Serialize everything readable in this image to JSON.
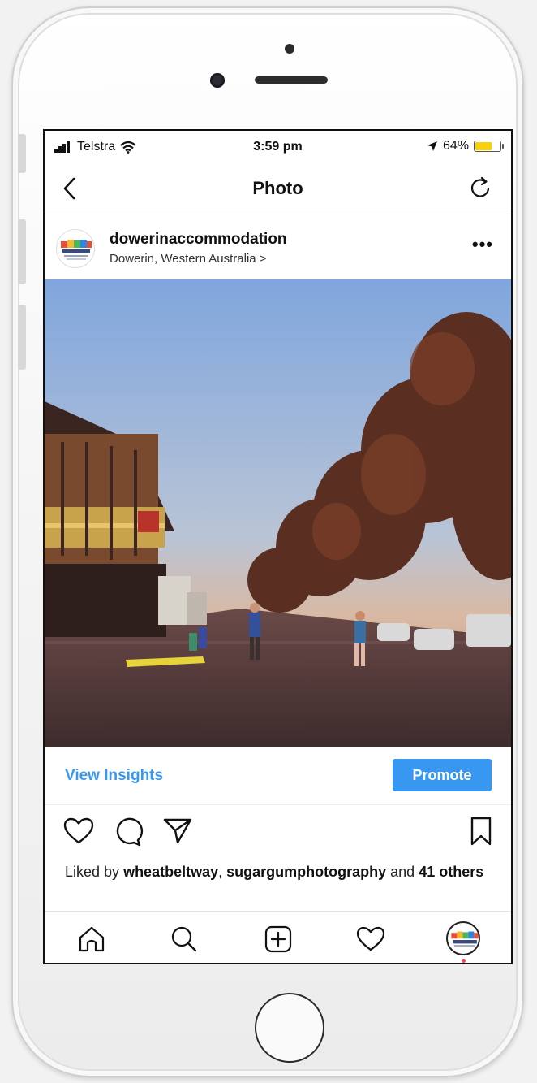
{
  "status_bar": {
    "carrier": "Telstra",
    "time": "3:59 pm",
    "battery": "64%",
    "battery_level": 0.64
  },
  "nav": {
    "title": "Photo"
  },
  "post": {
    "username": "dowerinaccommodation",
    "location": "Dowerin, Western Australia >"
  },
  "insights": {
    "view_label": "View Insights",
    "promote_label": "Promote"
  },
  "likes": {
    "prefix": "Liked by",
    "user1": "wheatbeltway",
    "sep": ",",
    "user2": "sugargumphotography",
    "and": "and",
    "others": "41 others"
  },
  "colors": {
    "accent": "#3897f0",
    "battery": "#f6d10c"
  },
  "icons": [
    "back-chevron-icon",
    "refresh-icon",
    "more-options-icon",
    "heart-icon",
    "comment-icon",
    "share-icon",
    "bookmark-icon",
    "home-icon",
    "search-icon",
    "add-post-icon",
    "activity-heart-icon",
    "profile-avatar"
  ]
}
